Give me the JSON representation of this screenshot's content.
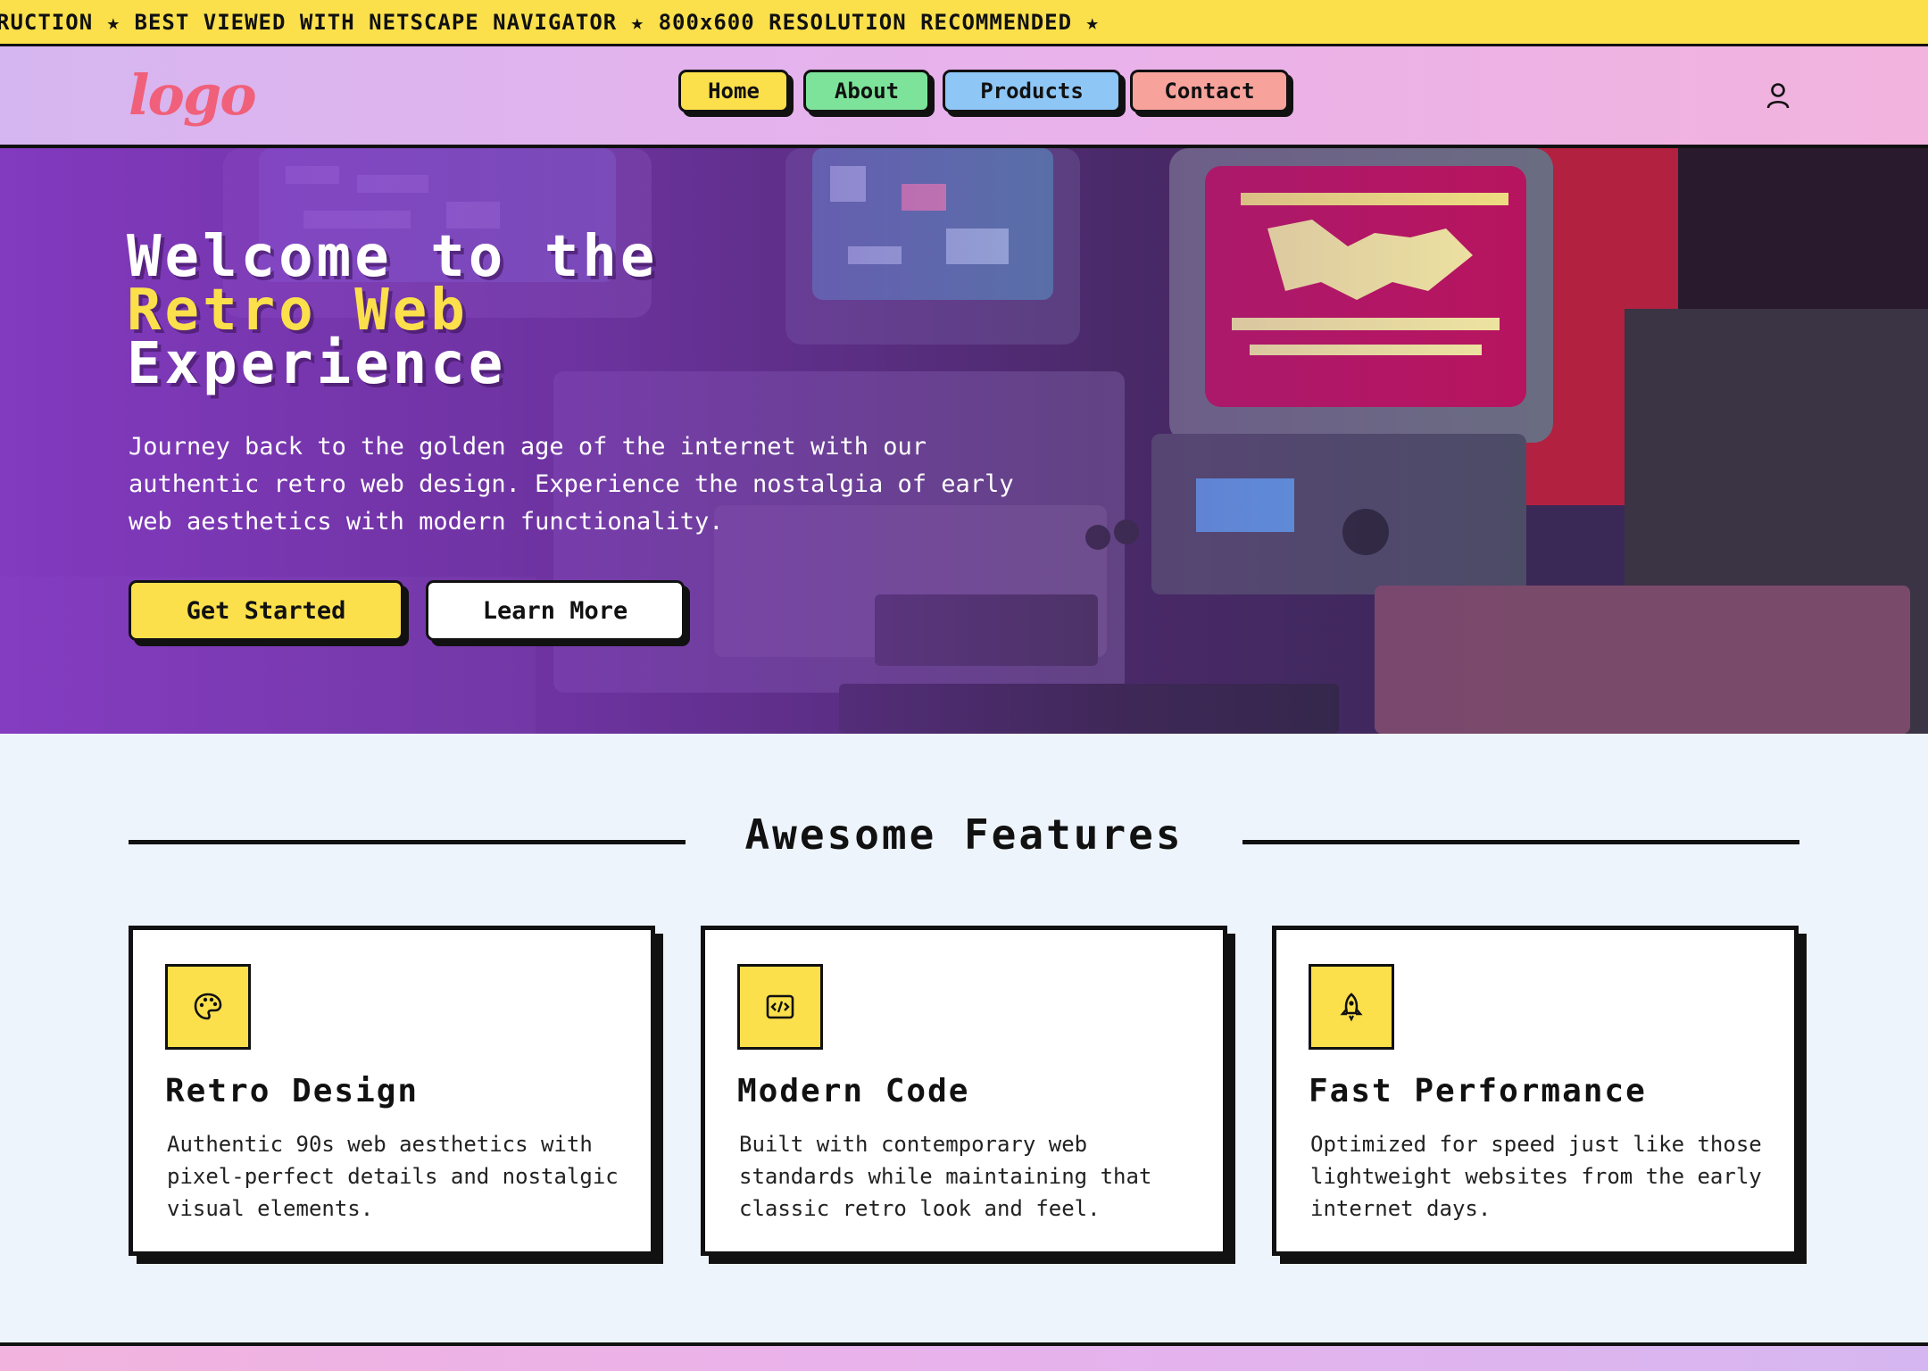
{
  "marquee": {
    "text": "RUCTION ★ BEST VIEWED WITH NETSCAPE NAVIGATOR ★ 800x600 RESOLUTION RECOMMENDED ★"
  },
  "header": {
    "logo": "logo",
    "nav": [
      {
        "label": "Home",
        "color": "#fbe04c"
      },
      {
        "label": "About",
        "color": "#7de39a"
      },
      {
        "label": "Products",
        "color": "#8ec6f5"
      },
      {
        "label": "Contact",
        "color": "#f7a39c"
      }
    ],
    "user_icon": "user-icon"
  },
  "hero": {
    "title_line1": "Welcome to the",
    "title_line2": "Retro Web",
    "title_line3": "Experience",
    "description": "Journey back to the golden age of the internet with our authentic retro web design. Experience the nostalgia of early web aesthetics with modern functionality.",
    "primary_button": "Get Started",
    "secondary_button": "Learn More"
  },
  "features": {
    "title": "Awesome Features",
    "cards": [
      {
        "icon": "palette-icon",
        "title": "Retro Design",
        "text": "Authentic 90s web aesthetics with pixel-perfect details and nostalgic visual elements."
      },
      {
        "icon": "code-icon",
        "title": "Modern Code",
        "text": "Built with contemporary web standards while maintaining that classic retro look and feel."
      },
      {
        "icon": "rocket-icon",
        "title": "Fast Performance",
        "text": "Optimized for speed just like those lightweight websites from the early internet days."
      }
    ]
  },
  "colors": {
    "accent_yellow": "#fbe04c",
    "logo_pink": "#f0607a",
    "ink": "#111111"
  }
}
